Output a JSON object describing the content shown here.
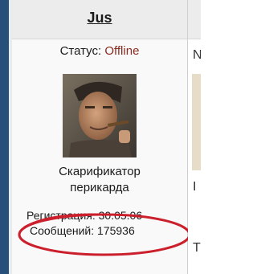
{
  "profile": {
    "username": "Jus",
    "status_label": "Статус:",
    "status_value": "Offline",
    "caption_line1": "Скарификатор",
    "caption_line2": "перикарда",
    "registration_label": "Регистрация:",
    "registration_date": "30.05.06",
    "posts_label": "Сообщений:",
    "posts_count": "175936"
  },
  "right_panel": {
    "glyph_1": "N",
    "glyph_2": "I",
    "glyph_3": "T"
  },
  "colors": {
    "status_offline": "#8b2a1e",
    "highlight_ellipse": "#cc1f2c",
    "sidebar_strip": "#26507a"
  },
  "icons": {
    "avatar": "user-avatar-photo"
  }
}
